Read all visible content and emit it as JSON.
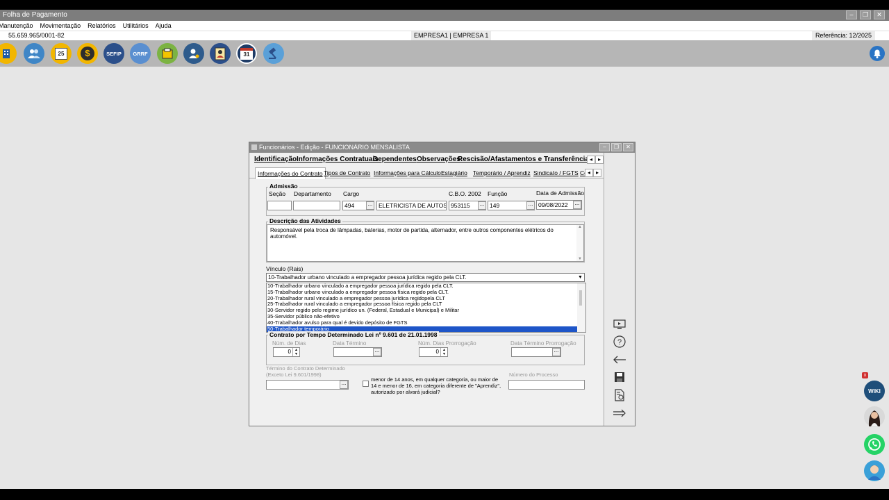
{
  "app": {
    "title": "Folha de Pagamento",
    "window_buttons": [
      "–",
      "❐",
      "✕"
    ]
  },
  "menu": [
    "Manutenção",
    "Movimentação",
    "Relatórios",
    "Utilitários",
    "Ajuda"
  ],
  "infobar": {
    "cnpj": "55.659.965/0001-82",
    "empresa": "EMPRESA1 | EMPRESA 1",
    "referencia": "Referência: 12/2025"
  },
  "toolbar": {
    "icons": [
      {
        "name": "company-icon",
        "label": "",
        "color": "#f2b600"
      },
      {
        "name": "employees-icon",
        "label": "",
        "color": "#3f86c6"
      },
      {
        "name": "calendar-25-icon",
        "label": "25",
        "color": "#f2b600"
      },
      {
        "name": "money-icon",
        "label": "$",
        "color": "#f2b600"
      },
      {
        "name": "sefip-icon",
        "label": "SEFIP",
        "color": "#2b4f8a"
      },
      {
        "name": "grrf-icon",
        "label": "GRRF",
        "color": "#5a8fd0"
      },
      {
        "name": "document-icon",
        "label": "",
        "color": "#7cb342"
      },
      {
        "name": "user-settings-icon",
        "label": "",
        "color": "#2e5b8c"
      },
      {
        "name": "employee-card-icon",
        "label": "",
        "color": "#2b4f8a"
      },
      {
        "name": "calendar-31-icon",
        "label": "31",
        "color": "#1e3b66"
      },
      {
        "name": "gavel-icon",
        "label": "",
        "color": "#5aa0d8"
      }
    ]
  },
  "dialog": {
    "title": "Funcionários - Edição - FUNCIONÁRIO MENSALISTA",
    "tabs_main": [
      "Identificação",
      "Informações Contratuais",
      "Dependentes",
      "Observações",
      "Rescisão/Afastamentos e Transferência/Bene"
    ],
    "tabs_sub": [
      "Informações do Contrato",
      "Tipos de Contrato",
      "Informações para Cálculo",
      "Estagiário",
      "Temporário / Aprendiz",
      "Sindicato / FGTS",
      "Co"
    ],
    "admissao": {
      "group_label": "Admissão",
      "secao_label": "Seção",
      "secao_value": "",
      "departamento_label": "Departamento",
      "departamento_value": "",
      "cargo_label": "Cargo",
      "cargo_code": "494",
      "cargo_name": "ELETRICISTA DE AUTOS",
      "cbo_label": "C.B.O. 2002",
      "cbo_value": "953115",
      "funcao_label": "Função",
      "funcao_value": "149",
      "data_admissao_label": "Data de Admissão",
      "data_admissao_value": "09/08/2022"
    },
    "descricao": {
      "group_label": "Descrição das Atividades",
      "text": "Responsável pela troca de lâmpadas, baterias, motor de partida, alternador, entre outros componentes elétricos do automóvel."
    },
    "vinculo": {
      "label": "Vínculo (Rais)",
      "selected": "10-Trabalhador urbano vinculado a empregador pessoa jurídica regido pela CLT.",
      "options": [
        "10-Trabalhador urbano vinculado a empregador pessoa jurídica regido pela CLT.",
        "15-Trabalhador urbano vinculado a empregador pessoa física regido pela CLT.",
        "20-Trabalhador rural vinculado a empregador pessoa jurídica regidopela CLT",
        "25-Trabalhador rural vinculado a empregador pessoa física regido pela CLT",
        "30-Servidor regido pelo regime jurídico un. (Federal, Estadual e Municipal) e Militar",
        "35-Servidor público não-efetivo",
        "40-Trabalhador avulso para qual é devido depósito de FGTS",
        "50-Trabalhador temporário"
      ],
      "highlighted_index": 7
    },
    "contrato": {
      "group_label": "Contrato por Tempo Determinado Lei nº 9.601 de 21.01.1998",
      "num_dias_label": "Núm. de Dias",
      "num_dias_value": "0",
      "data_termino_label": "Data Término",
      "data_termino_value": "",
      "num_dias_prorrogacao_label": "Núm. Dias Prorrogação",
      "num_dias_prorrogacao_value": "0",
      "data_termino_prorrogacao_label": "Data Término Prorrogação",
      "data_termino_prorrogacao_value": ""
    },
    "termino": {
      "label1": "Término do Contrato Determinado",
      "label2": "(Exceto Lei 9.601/1998)",
      "value": ""
    },
    "menor_checkbox_label": "menor de 14 anos, em qualquer categoria, ou maior de 14 e menor de 16, em categoria diferente de \"Aprendiz\", autorizado por alvará judicial?",
    "numero_processo_label": "Número do Processo",
    "numero_processo_value": ""
  },
  "side_actions": [
    "monitor-icon",
    "help-icon",
    "back-arrow-icon",
    "save-icon",
    "report-icon",
    "forward-arrow-icon"
  ],
  "floating": {
    "wiki_label": "WIKI",
    "close_label": "x"
  }
}
